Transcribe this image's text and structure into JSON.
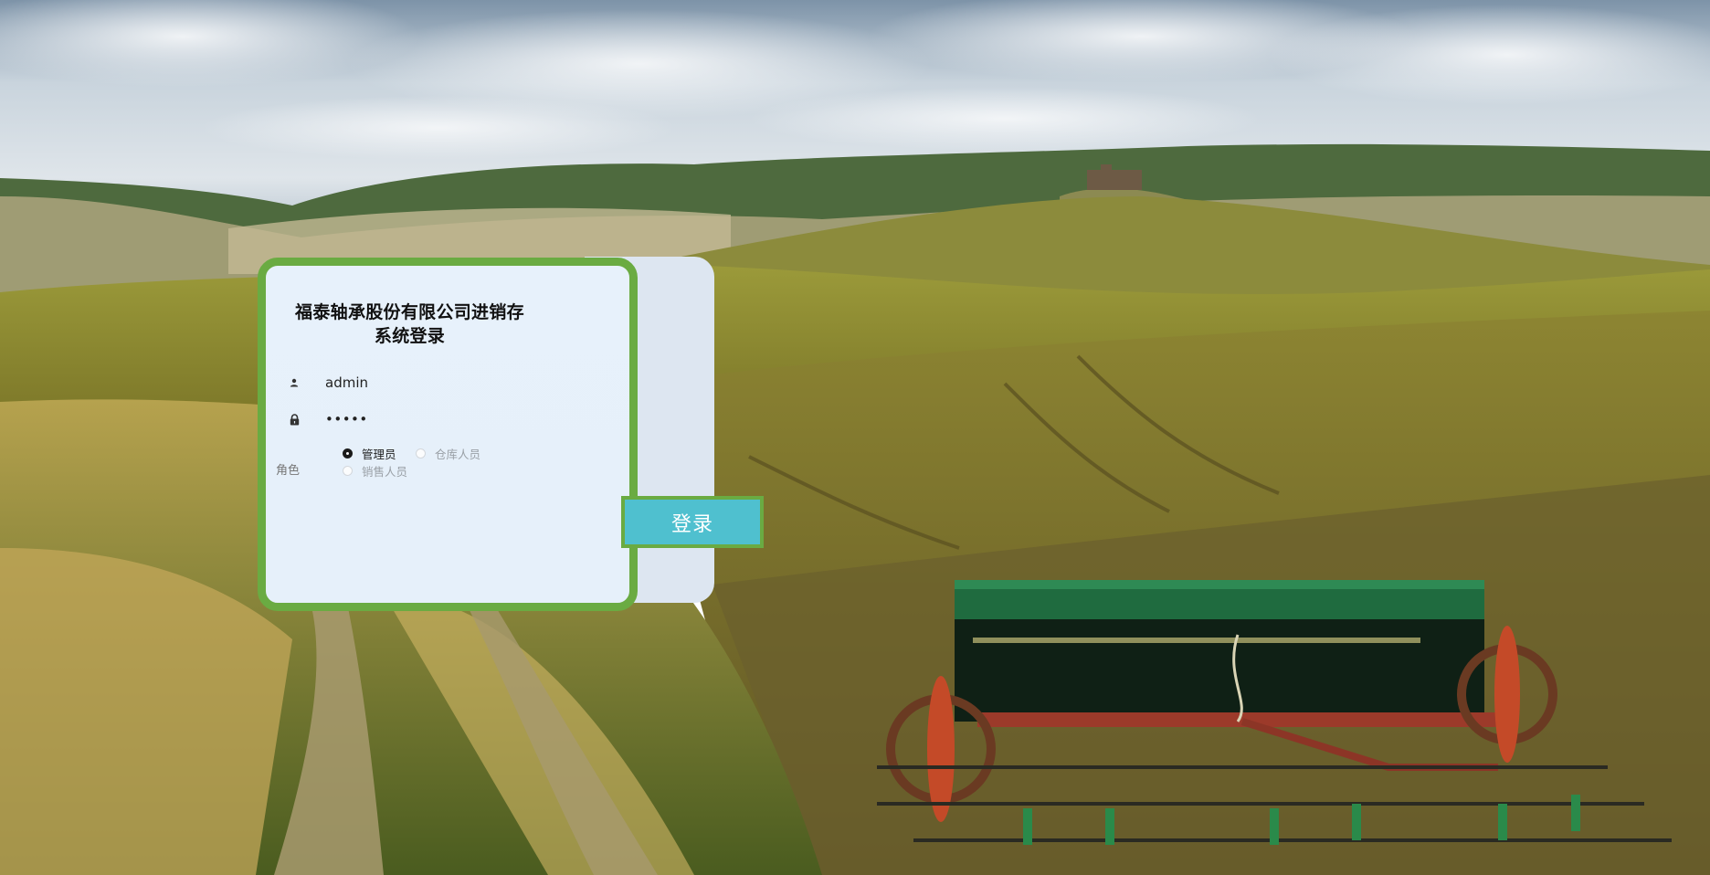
{
  "login": {
    "title": "福泰轴承股份有限公司进销存系统登录",
    "username": {
      "value": "admin",
      "icon": "user-icon"
    },
    "password": {
      "value": "•••••",
      "icon": "lock-icon"
    },
    "role_label": "角色",
    "roles": [
      {
        "label": "管理员",
        "checked": true
      },
      {
        "label": "仓库人员",
        "checked": false
      },
      {
        "label": "销售人员",
        "checked": false
      }
    ],
    "submit_label": "登录"
  },
  "colors": {
    "card_border": "#6aab42",
    "card_background": "#e7f1fb",
    "button_background": "#4fc0cf",
    "panel_back": "#dde6f1"
  },
  "background": {
    "description_icon": "landscape-background"
  }
}
